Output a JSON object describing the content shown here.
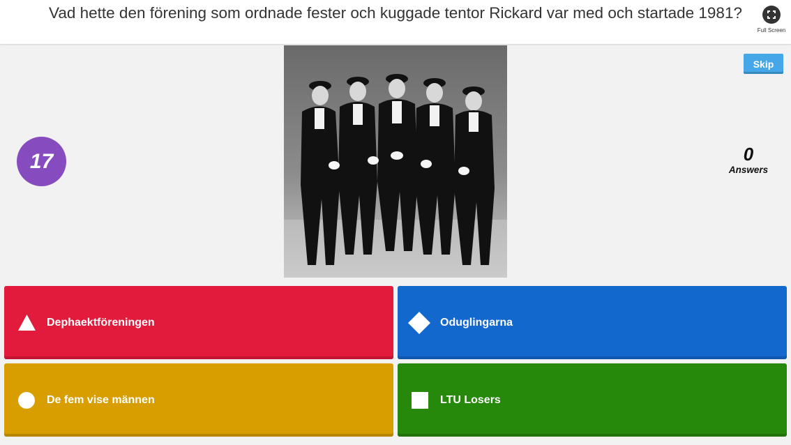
{
  "header": {
    "question": "Vad hette den förening som ordnade fester och kuggade tentor Rickard var med och startade 1981?",
    "fullscreen_label": "Full Screen",
    "fullscreen_icon": "fullscreen-icon"
  },
  "controls": {
    "skip_label": "Skip",
    "skip_color": "#46a7e8"
  },
  "timer": {
    "value": "17",
    "color": "#864cbf"
  },
  "answers_counter": {
    "count": "0",
    "label": "Answers"
  },
  "answers": [
    {
      "text": "Dephaektföreningen",
      "shape": "triangle-icon",
      "color": "#e21b3c"
    },
    {
      "text": "Oduglingarna",
      "shape": "diamond-icon",
      "color": "#1368ce"
    },
    {
      "text": "De fem vise männen",
      "shape": "circle-icon",
      "color": "#d89e00"
    },
    {
      "text": "LTU Losers",
      "shape": "square-icon",
      "color": "#26890c"
    }
  ]
}
